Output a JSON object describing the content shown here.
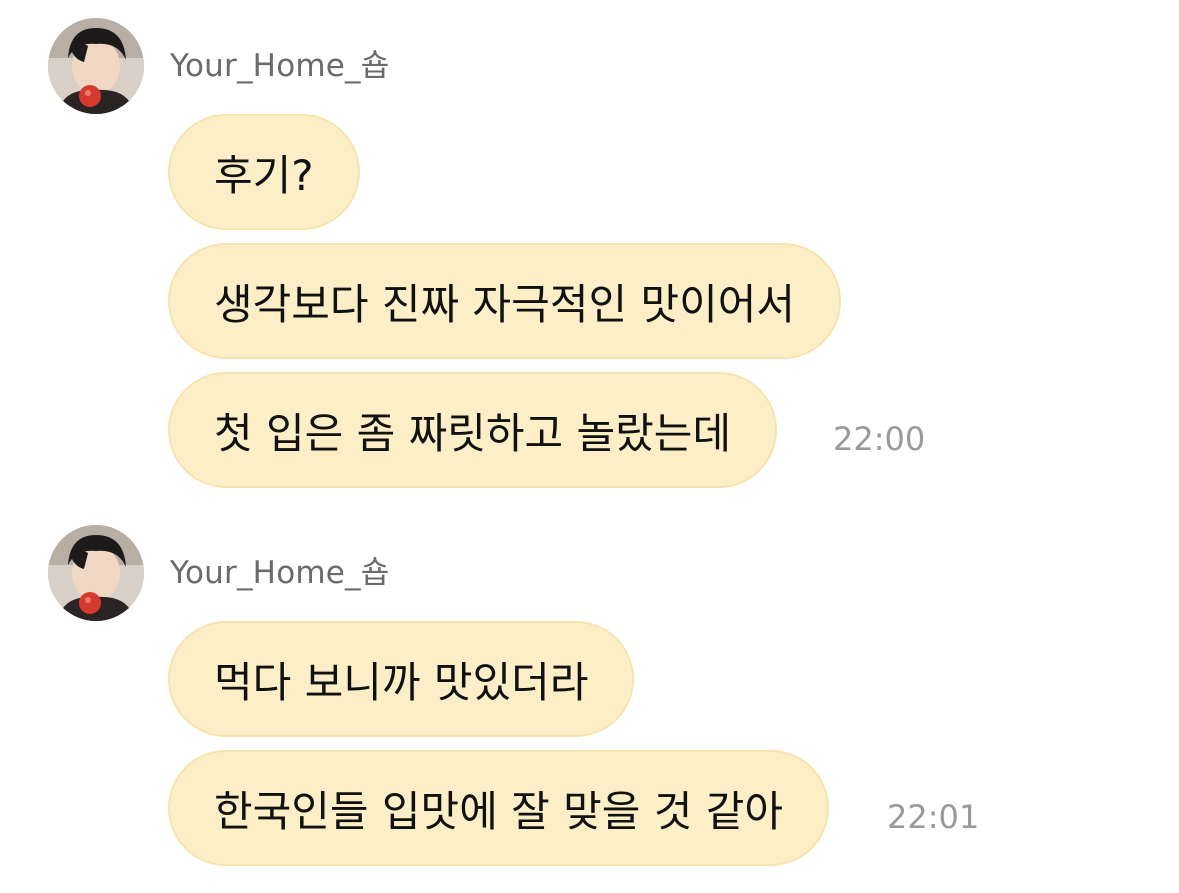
{
  "groups": [
    {
      "sender": "Your_Home_숍",
      "avatar_icon": "profile-photo-avatar",
      "messages": [
        "후기?",
        "생각보다 진짜 자극적인 맛이어서",
        "첫 입은 좀 짜릿하고 놀랐는데"
      ],
      "time": "22:00"
    },
    {
      "sender": "Your_Home_숍",
      "avatar_icon": "profile-photo-avatar",
      "messages": [
        "먹다 보니까 맛있더라",
        "한국인들 입맛에 잘 맞을 것 같아"
      ],
      "time": "22:01"
    }
  ],
  "colors": {
    "bubble": "#fcefc8",
    "bubble_border": "#f7e3ae",
    "sender_text": "#6b6b6b",
    "time_text": "#9a9a9a"
  }
}
